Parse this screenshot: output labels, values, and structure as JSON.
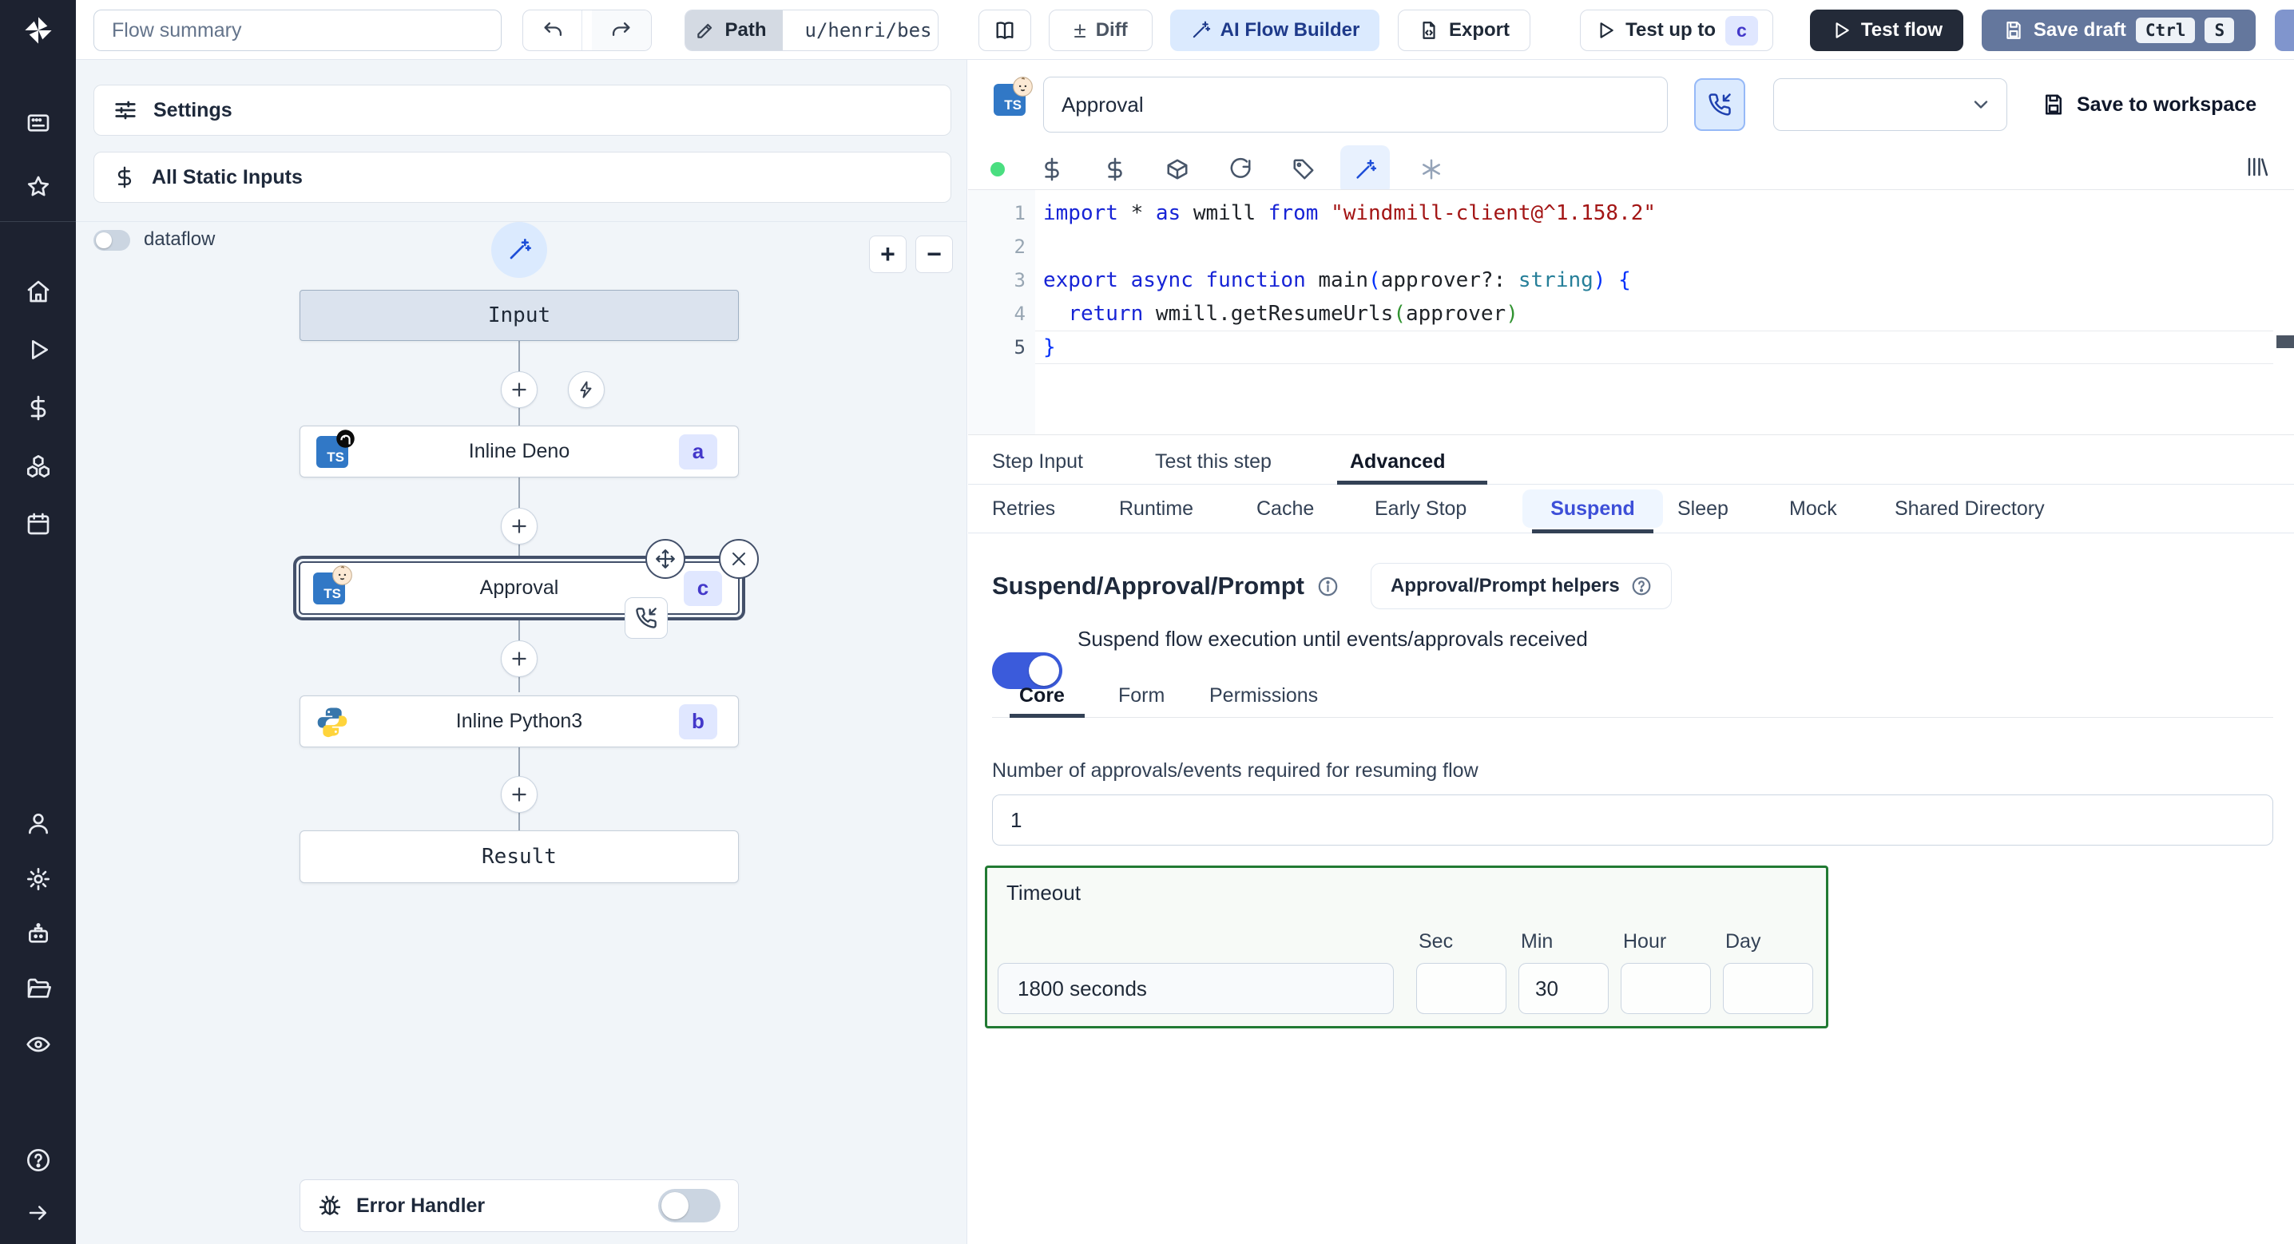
{
  "colors": {
    "toggle_on": "#3b5bdb",
    "badge_bg": "#e0e7ff",
    "badge_text": "#4338ca",
    "ai_button_bg": "#dbeafe",
    "ai_button_text": "#1e3a8a",
    "test_flow_bg": "#232a38",
    "save_draft_bg": "#64779d",
    "timeout_border": "#217a33",
    "code_keyword": "#1724d6",
    "code_string": "#a31515",
    "code_bracket_level1": "#0431fa",
    "code_bracket_level2": "#319331",
    "code_type": "#267f99"
  },
  "topbar": {
    "flow_summary_placeholder": "Flow summary",
    "path_label": "Path",
    "path_value": "u/henri/bes",
    "diff_label": "Diff",
    "ai_flow_builder_label": "AI Flow Builder",
    "export_label": "Export",
    "test_up_to_label": "Test up to",
    "test_up_to_badge": "c",
    "test_flow_label": "Test flow",
    "save_draft_label": "Save draft",
    "kbd_ctrl": "Ctrl",
    "kbd_s": "S"
  },
  "sidebar": {
    "icons": [
      "app-window-icon",
      "star-icon",
      "home-icon",
      "play-icon",
      "dollar-icon",
      "cubes-icon",
      "calendar-icon",
      "user-icon",
      "gear-icon",
      "robot-icon",
      "folder-icon",
      "eye-icon",
      "help-icon",
      "arrow-right-icon"
    ]
  },
  "flow_panel": {
    "settings_label": "Settings",
    "static_inputs_label": "All Static Inputs",
    "dataflow_label": "dataflow",
    "zoom_in": "+",
    "zoom_out": "−",
    "nodes": {
      "input_label": "Input",
      "deno": {
        "title": "Inline Deno",
        "badge": "a"
      },
      "approval": {
        "title": "Approval",
        "badge": "c"
      },
      "python": {
        "title": "Inline Python3",
        "badge": "b"
      },
      "result_label": "Result"
    },
    "error_handler_label": "Error Handler"
  },
  "step_editor": {
    "title_value": "Approval",
    "save_to_workspace_label": "Save to workspace",
    "code": {
      "lines": [
        {
          "n": "1",
          "tokens": [
            {
              "t": "import",
              "c": "kw"
            },
            {
              "t": " * ",
              "c": "pl"
            },
            {
              "t": "as",
              "c": "kw"
            },
            {
              "t": " wmill ",
              "c": "pl"
            },
            {
              "t": "from",
              "c": "kw"
            },
            {
              "t": " ",
              "c": "pl"
            },
            {
              "t": "\"windmill-client@^1.158.2\"",
              "c": "str"
            }
          ]
        },
        {
          "n": "2",
          "tokens": []
        },
        {
          "n": "3",
          "tokens": [
            {
              "t": "export",
              "c": "kw"
            },
            {
              "t": " ",
              "c": "pl"
            },
            {
              "t": "async",
              "c": "kw"
            },
            {
              "t": " ",
              "c": "pl"
            },
            {
              "t": "function",
              "c": "kw"
            },
            {
              "t": " main",
              "c": "pl"
            },
            {
              "t": "(",
              "c": "br1"
            },
            {
              "t": "approver?: ",
              "c": "pl"
            },
            {
              "t": "string",
              "c": "ty"
            },
            {
              "t": ")",
              "c": "br1"
            },
            {
              "t": " ",
              "c": "pl"
            },
            {
              "t": "{",
              "c": "br1"
            }
          ]
        },
        {
          "n": "4",
          "tokens": [
            {
              "t": "  ",
              "c": "pl"
            },
            {
              "t": "return",
              "c": "kw"
            },
            {
              "t": " wmill.getResumeUrls",
              "c": "pl"
            },
            {
              "t": "(",
              "c": "br2"
            },
            {
              "t": "approver",
              "c": "pl"
            },
            {
              "t": ")",
              "c": "br2"
            }
          ]
        },
        {
          "n": "5",
          "tokens": [
            {
              "t": "}",
              "c": "br1"
            }
          ]
        }
      ]
    },
    "tabs": [
      {
        "label": "Step Input"
      },
      {
        "label": "Test this step"
      },
      {
        "label": "Advanced",
        "active": true
      }
    ],
    "advanced_tabs": [
      {
        "label": "Retries"
      },
      {
        "label": "Runtime"
      },
      {
        "label": "Cache"
      },
      {
        "label": "Early Stop"
      },
      {
        "label": "Suspend",
        "active": true
      },
      {
        "label": "Sleep"
      },
      {
        "label": "Mock"
      },
      {
        "label": "Shared Directory"
      }
    ]
  },
  "suspend": {
    "heading": "Suspend/Approval/Prompt",
    "helpers_button_label": "Approval/Prompt helpers",
    "toggle_label": "Suspend flow execution until events/approvals received",
    "subtabs": [
      {
        "label": "Core",
        "active": true
      },
      {
        "label": "Form"
      },
      {
        "label": "Permissions"
      }
    ],
    "approvals_label": "Number of approvals/events required for resuming flow",
    "approvals_value": "1",
    "timeout": {
      "label": "Timeout",
      "seconds_value": "1800 seconds",
      "columns": [
        "Sec",
        "Min",
        "Hour",
        "Day"
      ],
      "sec_value": "",
      "min_value": "30",
      "hour_value": "",
      "day_value": ""
    }
  }
}
